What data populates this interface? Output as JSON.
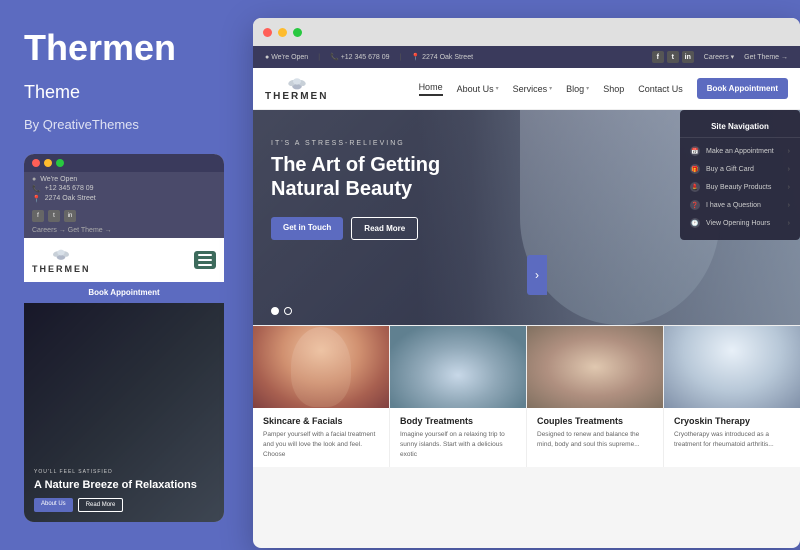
{
  "left_panel": {
    "brand_title": "Thermen",
    "brand_subtitle": "Theme",
    "brand_by": "By QreativeThemes"
  },
  "mobile_preview": {
    "dots": [
      "red",
      "yellow",
      "green"
    ],
    "topbar_items": [
      {
        "icon": "wifi",
        "text": "We're Open"
      },
      {
        "icon": "phone",
        "text": "+12 345 678 09"
      },
      {
        "icon": "location",
        "text": "2274 Oak Street"
      }
    ],
    "social_icons": [
      "f",
      "t",
      "in"
    ],
    "careers_text": "Careers →  Get Theme →",
    "logo_text": "THERMEN",
    "book_btn": "Book Appointment",
    "hero_tag": "YOU'LL FEEL SATISFIED",
    "hero_title": "A Nature Breeze of Relaxations",
    "hero_btn1": "About Us",
    "hero_btn2": "Read More"
  },
  "browser": {
    "dots": [
      "red",
      "yellow",
      "green"
    ],
    "topbar": {
      "open_text": "We're Open",
      "phone": "+12 345 678 09",
      "address": "2274 Oak Street",
      "social": [
        "f",
        "t",
        "in"
      ],
      "careers": "Careers ▾",
      "get_theme": "Get Theme →"
    },
    "navbar": {
      "logo_text": "THERMEN",
      "nav_links": [
        {
          "label": "Home",
          "active": true
        },
        {
          "label": "About Us",
          "has_arrow": true
        },
        {
          "label": "Services",
          "has_arrow": true
        },
        {
          "label": "Blog",
          "has_arrow": true
        },
        {
          "label": "Shop"
        },
        {
          "label": "Contact Us"
        }
      ],
      "book_btn": "Book Appointment"
    },
    "hero": {
      "tag": "IT'S A STRESS-RELIEVING",
      "title_line1": "The Art of Getting",
      "title_line2": "Natural Beauty",
      "btn1": "Get in Touch",
      "btn2": "Read More",
      "dots": [
        true,
        false
      ]
    },
    "site_nav": {
      "title": "Site Navigation",
      "items": [
        {
          "icon": "📅",
          "label": "Make an Appointment"
        },
        {
          "icon": "🎁",
          "label": "Buy a Gift Card"
        },
        {
          "icon": "💄",
          "label": "Buy Beauty Products"
        },
        {
          "icon": "❓",
          "label": "I have a Question"
        },
        {
          "icon": "🕐",
          "label": "View Opening Hours"
        }
      ]
    },
    "service_cards": [
      {
        "title": "Skincare & Facials",
        "desc": "Pamper yourself with a facial treatment and you will love the look and feel. Choose"
      },
      {
        "title": "Body Treatments",
        "desc": "Imagine yourself on a relaxing trip to sunny islands. Start with a delicious exotic"
      },
      {
        "title": "Couples Treatments",
        "desc": "Designed to renew and balance the mind, body and soul this supreme..."
      },
      {
        "title": "Cryoskin Therapy",
        "desc": "Cryotherapy was introduced as a treatment for rheumatoid arthritis..."
      }
    ]
  },
  "right_arrow": "›"
}
